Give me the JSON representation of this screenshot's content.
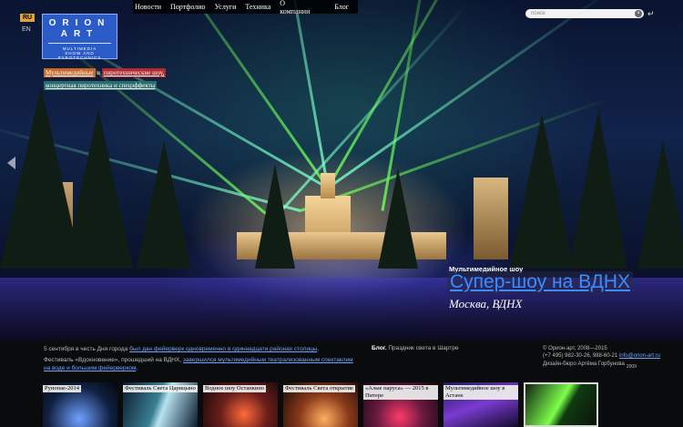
{
  "lang": {
    "active": "RU",
    "other": "EN"
  },
  "logo": {
    "line1": "ORION",
    "line2": "ART",
    "line3": "MULTIMEDIA",
    "line4": "SHOW AND PYROTECHNICS"
  },
  "nav": {
    "items": [
      "Новости",
      "Портфолио",
      "Услуги",
      "Техника",
      "О компании"
    ],
    "blog": "Блог"
  },
  "search": {
    "placeholder": "поиск"
  },
  "tags": {
    "multimedia": "Мультимедийные",
    "and": "и",
    "pyro": "пиротехнические шоу,",
    "concert": "концертная пиротехника и спецэффекты"
  },
  "hero": {
    "kicker": "Мультимедийное шоу",
    "title": "Супер-шоу на ВДНХ",
    "place": "Москва, ВДНХ"
  },
  "news": {
    "item1_pre": "5 сентября в честь Дня города ",
    "item1_link": "был дан фейерверк одновременно в одиннадцати районах столицы",
    "item1_post": ".",
    "item2_pre": "Фестиваль «Вдохновение», прошедший на ВДНХ, ",
    "item2_link": "завершился мультимедийным театрализованным спектаклем на воде и большим фейерверком",
    "item2_post": "."
  },
  "blog_teaser": {
    "label": "Блог.",
    "text": "Праздник света в Шартре"
  },
  "footer": {
    "copyright": "© Орион-арт, 2008—2015",
    "phones": "(+7 495) 982-30-26, 988-60-21",
    "email": "info@orion-art.ru",
    "credit": "Дизайн-бюро Артёма Горбунова",
    "credit_year": "2009"
  },
  "thumbs": [
    {
      "caption": "Рунопае-2014"
    },
    {
      "caption": "Фестиваль Света Царицыно"
    },
    {
      "caption": "Водное шоу Останкино"
    },
    {
      "caption": "Фестиваль Света открытие"
    },
    {
      "caption": "«Алые паруса» — 2015 в Питере"
    },
    {
      "caption": "Мультимедийное шоу в Астане"
    },
    {
      "caption": ""
    }
  ],
  "colors": {
    "accent_link": "#3a8cff",
    "lang_active": "#e2a43a",
    "logo_bg": "#2b5bc7"
  }
}
